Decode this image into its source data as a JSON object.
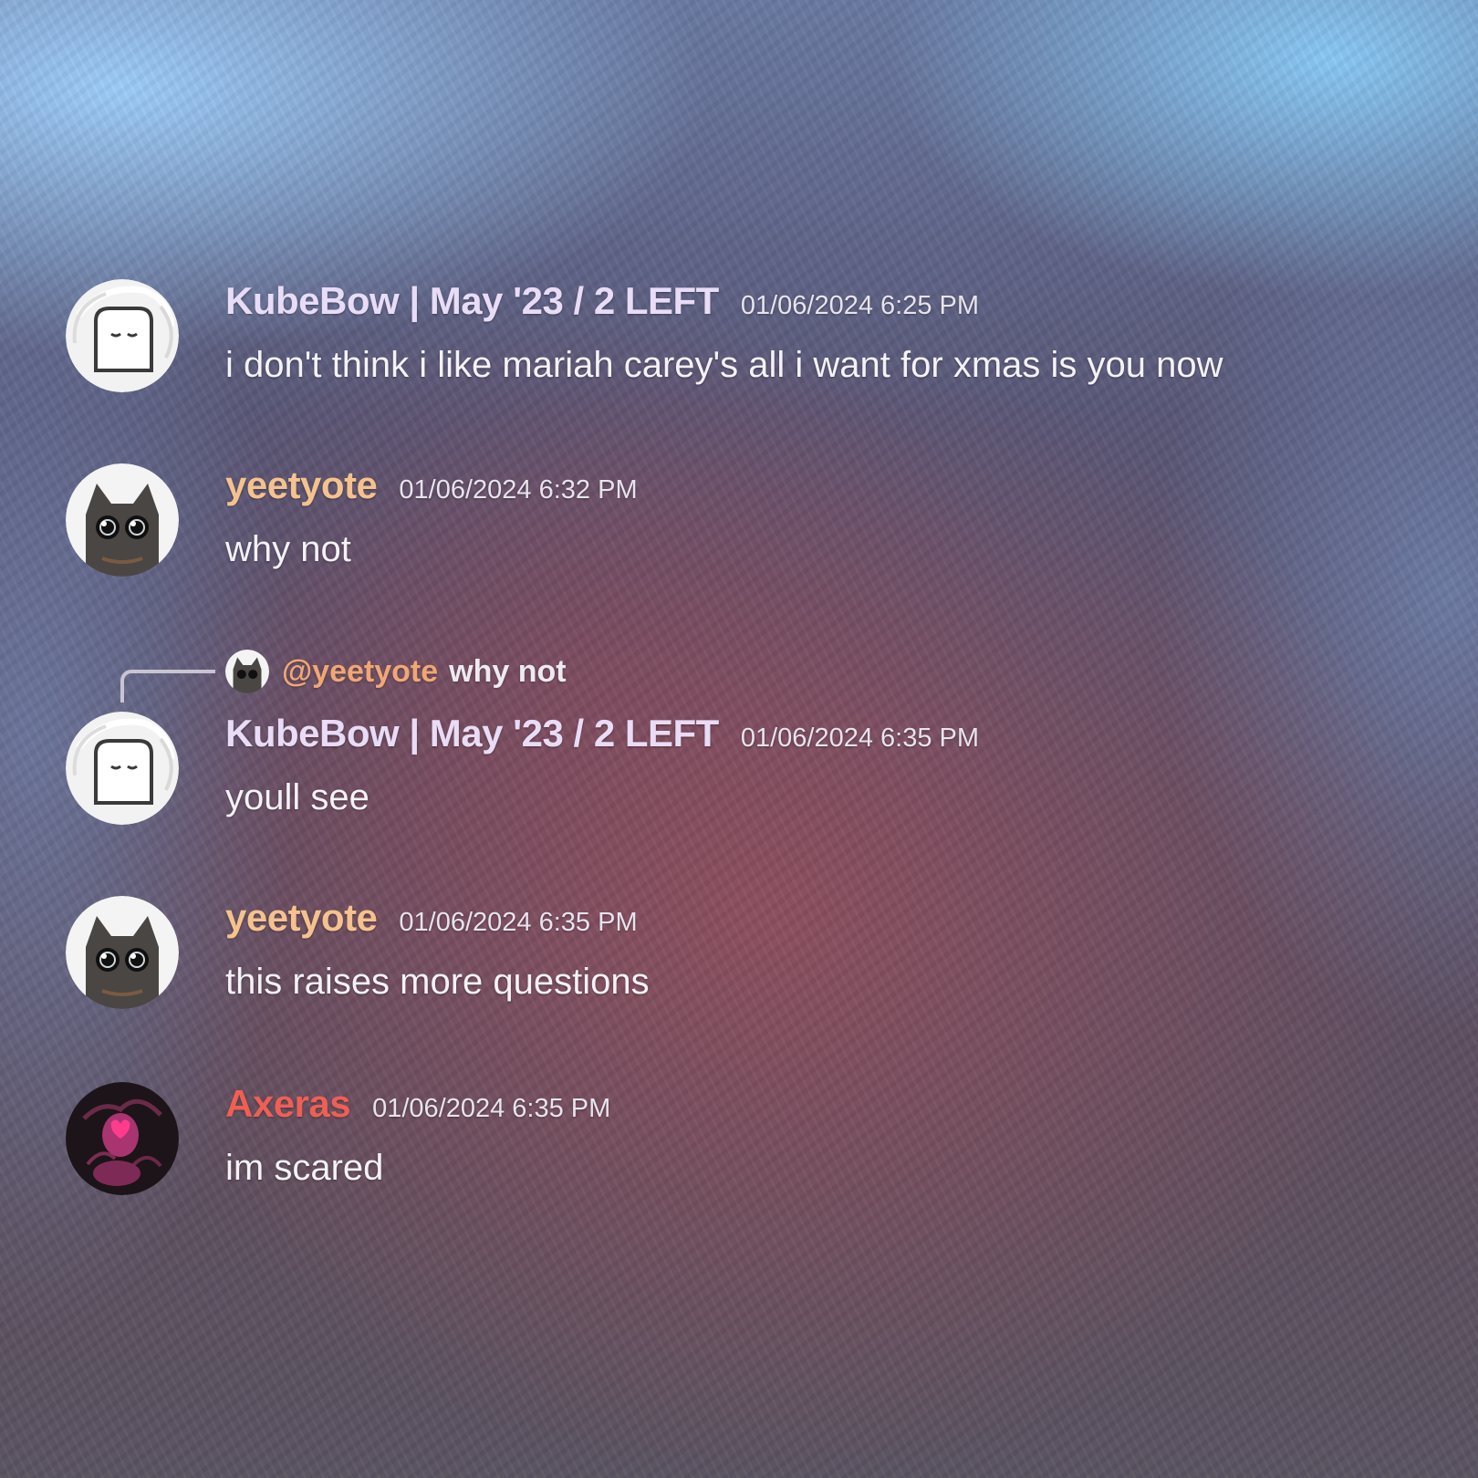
{
  "messages": [
    {
      "author": "KubeBow | May '23 / 2 LEFT",
      "author_color": "#e8dcf6",
      "timestamp": "01/06/2024 6:25 PM",
      "text": "i don't think i like mariah carey's all i want for xmas is you now",
      "avatar_icon": "toast-icon"
    },
    {
      "author": "yeetyote",
      "author_color": "#f5c28e",
      "timestamp": "01/06/2024 6:32 PM",
      "text": "why not",
      "avatar_icon": "cat-icon"
    },
    {
      "author": "KubeBow | May '23 / 2 LEFT",
      "author_color": "#e8dcf6",
      "timestamp": "01/06/2024 6:35 PM",
      "text": "youll see",
      "avatar_icon": "toast-icon",
      "reply_to": {
        "mention": "@yeetyote",
        "text": "why not"
      }
    },
    {
      "author": "yeetyote",
      "author_color": "#f5c28e",
      "timestamp": "01/06/2024 6:35 PM",
      "text": "this raises more questions",
      "avatar_icon": "cat-icon"
    },
    {
      "author": "Axeras",
      "author_color": "#ef5f54",
      "timestamp": "01/06/2024 6:35 PM",
      "text": "im scared",
      "avatar_icon": "pink-figure-icon"
    }
  ]
}
